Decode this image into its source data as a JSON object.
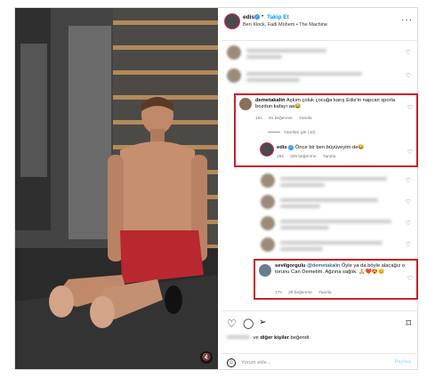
{
  "post": {
    "username": "edis",
    "verified_mark": "✓",
    "separator": "•",
    "follow_label": "Takip Et",
    "audio_line": "Ben Klock, Fadi Mohem • The Machine",
    "more_icon": "more-horizontal-icon"
  },
  "comments": [
    {
      "username": "demetakalin",
      "text": "Aşkım çoluk çocuğa karış Edis'in napcan sporla bozdun kafayı aa😂",
      "time": "15s",
      "likes": "91 beğenme",
      "reply_label": "Yanıtla",
      "view_replies": "Yanıtları gör (10)",
      "highlighted": true
    },
    {
      "username": "edis",
      "text": "Önce bir ben büyüyeyim de😂",
      "time": "15s",
      "likes": "326 beğenme",
      "reply_label": "Yanıtla",
      "is_reply": true,
      "highlighted": true
    },
    {
      "username": "sevilgorgulu",
      "mention": "@demetakalin",
      "text": "Öyle ya da böyle alacağız o torunu Can Demetim. Ağzına sağlık. 🙏❤️😍😊",
      "time": "17s",
      "likes": "29 beğenme",
      "reply_label": "Yanıtla",
      "highlighted": true
    }
  ],
  "actions": {
    "like_icon": "heart-icon",
    "comment_icon": "comment-icon",
    "share_icon": "share-icon",
    "save_icon": "bookmark-icon"
  },
  "likes_line": {
    "middle": "ve",
    "others": "diğer kişiler",
    "suffix": "beğendi"
  },
  "add_comment": {
    "placeholder": "Yorum ekle...",
    "post_label": "Paylaş",
    "emoji_icon": "emoji-icon"
  },
  "colors": {
    "highlight_border": "#d0202a",
    "link_blue": "#0095f6",
    "verified_blue": "#3897f0",
    "muted_text": "#737373"
  }
}
